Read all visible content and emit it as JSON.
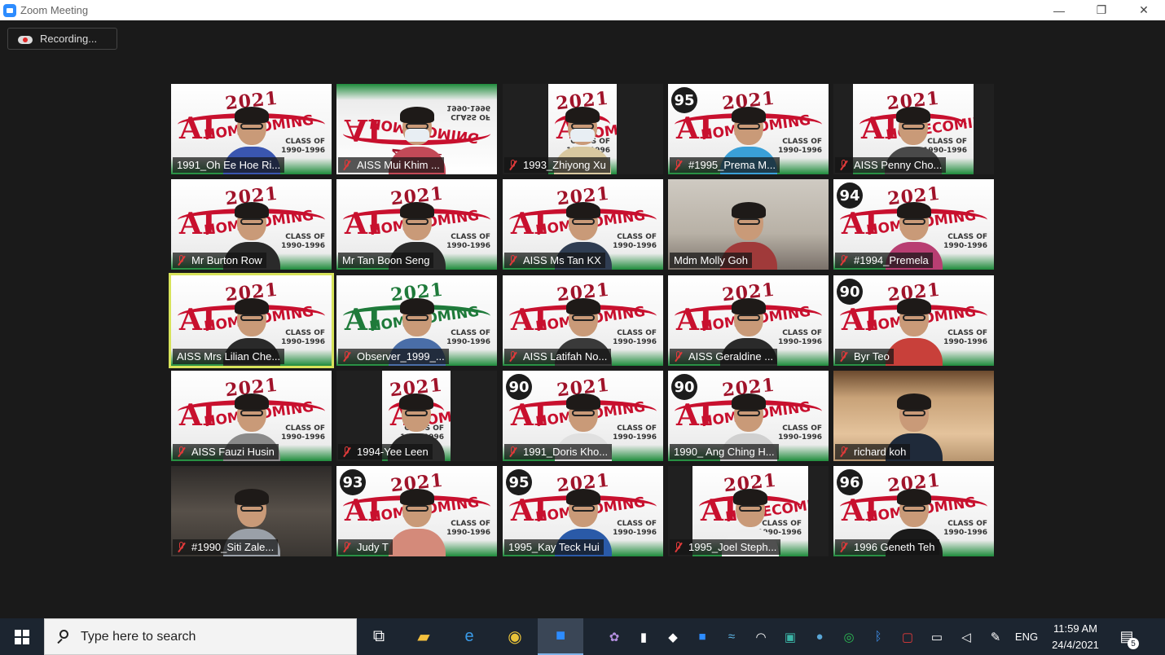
{
  "window": {
    "title": "Zoom Meeting",
    "controls": [
      "—",
      "❐",
      "✕"
    ]
  },
  "recording": {
    "label": "Recording..."
  },
  "participants": [
    {
      "name": "1991_Oh Ee Hoe Ri...",
      "muted": false,
      "badge": ""
    },
    {
      "name": "AISS Mui Khim ...",
      "muted": true,
      "badge": ""
    },
    {
      "name": "1993_Zhiyong Xu",
      "muted": true,
      "badge": ""
    },
    {
      "name": "#1995_Prema M...",
      "muted": true,
      "badge": "95"
    },
    {
      "name": "AISS Penny Cho...",
      "muted": true,
      "badge": ""
    },
    {
      "name": "Mr Burton Row",
      "muted": true,
      "badge": ""
    },
    {
      "name": "Mr Tan Boon Seng",
      "muted": false,
      "badge": ""
    },
    {
      "name": "AISS Ms Tan KX",
      "muted": true,
      "badge": ""
    },
    {
      "name": "Mdm Molly Goh",
      "muted": false,
      "badge": ""
    },
    {
      "name": "#1994_Premela",
      "muted": true,
      "badge": "94"
    },
    {
      "name": "AISS Mrs Lilian Che...",
      "muted": false,
      "badge": "",
      "active": true
    },
    {
      "name": "Observer_1999_...",
      "muted": true,
      "badge": ""
    },
    {
      "name": "AISS Latifah No...",
      "muted": true,
      "badge": ""
    },
    {
      "name": "AISS Geraldine ...",
      "muted": true,
      "badge": ""
    },
    {
      "name": "Byr Teo",
      "muted": true,
      "badge": "90"
    },
    {
      "name": "AISS Fauzi Husin",
      "muted": true,
      "badge": ""
    },
    {
      "name": "1994-Yee Leen",
      "muted": true,
      "badge": ""
    },
    {
      "name": "1991_Doris Kho...",
      "muted": true,
      "badge": "90"
    },
    {
      "name": "1990_ Ang Ching H...",
      "muted": false,
      "badge": "90"
    },
    {
      "name": "richard koh",
      "muted": true,
      "badge": ""
    },
    {
      "name": "#1990_Siti Zale...",
      "muted": true,
      "badge": ""
    },
    {
      "name": "Judy T",
      "muted": true,
      "badge": "93"
    },
    {
      "name": "1995_Kay Teck Hui",
      "muted": false,
      "badge": "95"
    },
    {
      "name": "1995_Joel Steph...",
      "muted": true,
      "badge": ""
    },
    {
      "name": "1996 Geneth Teh",
      "muted": true,
      "badge": "96"
    }
  ],
  "banner": {
    "year": "2021",
    "text": "HOMECOMING",
    "ai": "AI",
    "class_text": "CLASS OF\n1990-1996"
  },
  "taskbar": {
    "search_placeholder": "Type here to search",
    "language": "ENG",
    "time": "11:59 AM",
    "date": "24/4/2021",
    "notification_count": "5"
  },
  "colors": {
    "active_speaker": "#d7e35a",
    "muted_icon": "#e03a3a",
    "zoom_blue": "#2d8cff",
    "taskbar": "#1c2530"
  }
}
